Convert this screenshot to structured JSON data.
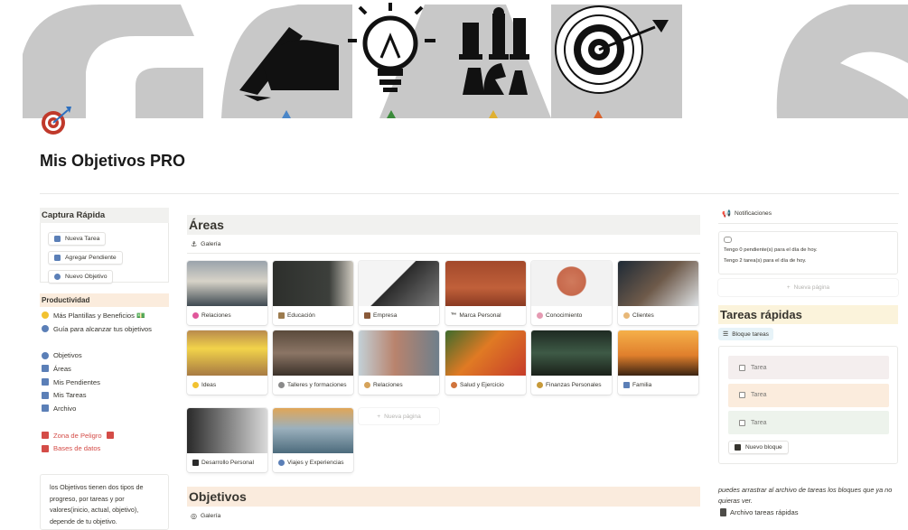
{
  "page": {
    "title": "Mis Objetivos PRO",
    "icon": "target-dart-icon"
  },
  "cover": {
    "name": "goals-cover-banner"
  },
  "quick_capture": {
    "title": "Captura Rápida",
    "buttons": [
      "Nueva Tarea",
      "Agregar Pendiente",
      "Nuevo Objetivo"
    ]
  },
  "productivity": {
    "title": "Productividad",
    "links": [
      "Más Plantillas y Beneficios 💵",
      "Guía para alcanzar tus objetivos"
    ]
  },
  "nav_links": [
    "Objetivos",
    "Áreas",
    "Mis Pendientes",
    "Mis Tareas",
    "Archivo"
  ],
  "danger": {
    "zone": "Zona de Peligro",
    "databases": "Bases de datos"
  },
  "note": "los Objetivos tienen dos tipos de progreso, por tareas y por valores(inicio, actual, objetivo), depende de tu objetivo.",
  "areas": {
    "title": "Áreas",
    "view": "Galería",
    "new_page": "Nueva página",
    "cards": [
      "Relaciones",
      "Educación",
      "Empresa",
      "Marca Personal",
      "Conocimiento",
      "Clientes",
      "Ideas",
      "Talleres y formaciones",
      "Relaciones",
      "Salud y Ejercicio",
      "Finanzas Personales",
      "Familia",
      "Desarrollo Personal",
      "Viajes y Experiencias"
    ]
  },
  "objetivos": {
    "title": "Objetivos",
    "view": "Galería"
  },
  "notifications": {
    "title": "Notificaciones",
    "line1": "Tengo 0 pendiente(s) para el día de hoy.",
    "line2": "Tengo 2 tarea(s) para el día de hoy.",
    "new_page": "Nueva página"
  },
  "quick_tasks": {
    "title": "Tareas rápidas",
    "block_button": "Bloque tareas",
    "tasks": [
      "Tarea",
      "Tarea",
      "Tarea"
    ],
    "new_block": "Nuevo bloque",
    "drag_note": "puedes arrastrar al archivo de tareas los bloques que ya no quieras ver.",
    "archive_link": "Archivo tareas rápidas"
  },
  "colors": {
    "task_colors": [
      "#f4eeee",
      "#fbecdd",
      "#edf3ec"
    ],
    "accent_blue": "#5b7fb7",
    "danger_red": "#d44c47"
  }
}
